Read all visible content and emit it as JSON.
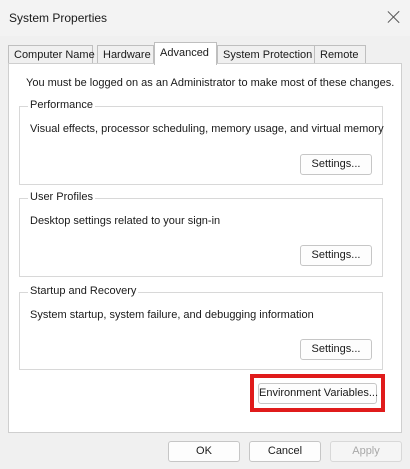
{
  "window": {
    "title": "System Properties"
  },
  "tabs": [
    {
      "label": "Computer Name",
      "active": false
    },
    {
      "label": "Hardware",
      "active": false
    },
    {
      "label": "Advanced",
      "active": true
    },
    {
      "label": "System Protection",
      "active": false
    },
    {
      "label": "Remote",
      "active": false
    }
  ],
  "advanced": {
    "admin_note": "You must be logged on as an Administrator to make most of these changes.",
    "performance": {
      "legend": "Performance",
      "description": "Visual effects, processor scheduling, memory usage, and virtual memory",
      "button": "Settings..."
    },
    "user_profiles": {
      "legend": "User Profiles",
      "description": "Desktop settings related to your sign-in",
      "button": "Settings..."
    },
    "startup_recovery": {
      "legend": "Startup and Recovery",
      "description": "System startup, system failure, and debugging information",
      "button": "Settings..."
    },
    "env_button": "Environment Variables...",
    "highlight_color": "#e01b1b"
  },
  "footer": {
    "ok": "OK",
    "cancel": "Cancel",
    "apply": "Apply"
  }
}
